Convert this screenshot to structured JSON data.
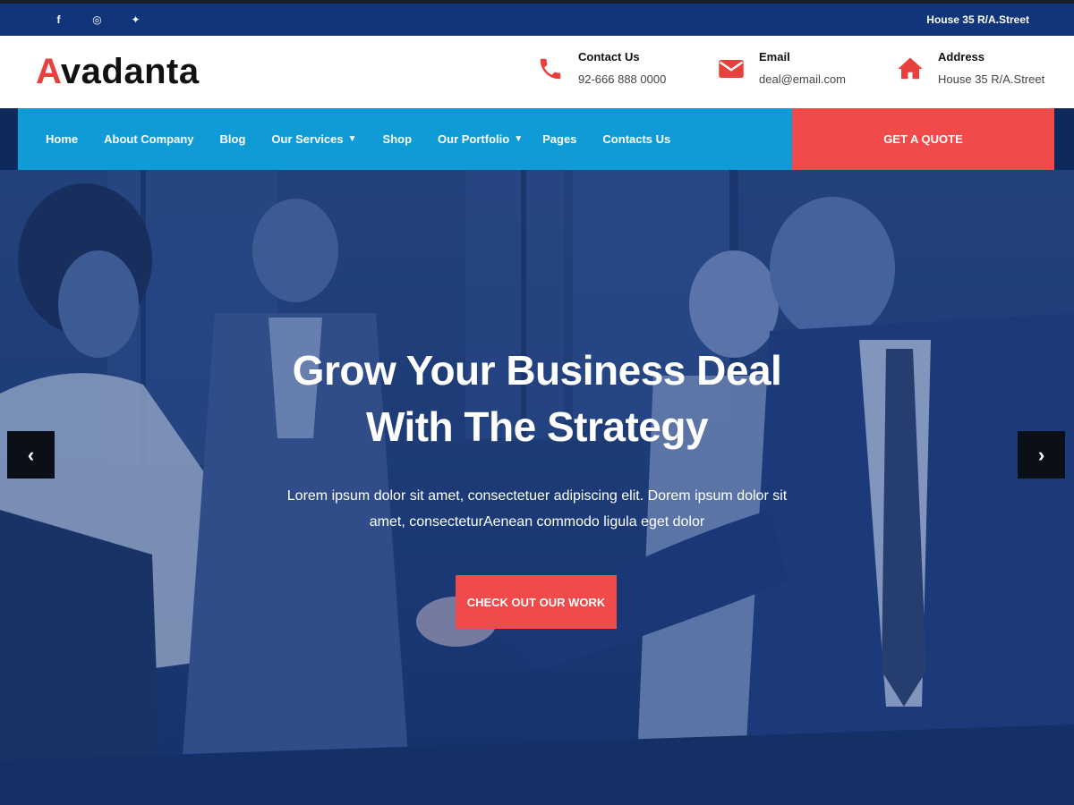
{
  "topbar": {
    "social": [
      {
        "icon": "facebook-icon",
        "glyph": "f"
      },
      {
        "icon": "instagram-icon",
        "glyph": "◎"
      },
      {
        "icon": "twitter-icon",
        "glyph": "✦"
      }
    ],
    "address": "House 35 R/A.Street"
  },
  "header": {
    "logo_first": "A",
    "logo_rest": "vadanta",
    "contact": {
      "label": "Contact Us",
      "value": "92-666 888 0000",
      "icon": "phone-icon"
    },
    "email": {
      "label": "Email",
      "value": "deal@email.com",
      "icon": "mail-icon"
    },
    "address": {
      "label": "Address",
      "value": "House 35 R/A.Street",
      "icon": "home-icon"
    }
  },
  "nav": {
    "items": [
      {
        "label": "Home"
      },
      {
        "label": "About Company"
      },
      {
        "label": "Blog"
      },
      {
        "label": "Our Services",
        "dropdown": true
      },
      {
        "label": "Shop"
      },
      {
        "label": "Our Portfolio",
        "dropdown": true
      },
      {
        "label": "Pages"
      },
      {
        "label": "Contacts Us"
      }
    ],
    "quote_label": "GET A QUOTE"
  },
  "hero": {
    "title_line1": "Grow Your Business Deal",
    "title_line2": "With The Strategy",
    "subtitle_line1": "Lorem ipsum dolor sit amet, consectetuer adipiscing elit. Dorem ipsum dolor sit",
    "subtitle_line2": "amet, consecteturAenean commodo ligula eget dolor",
    "cta_label": "CHECK OUT OUR WORK",
    "prev_glyph": "‹",
    "next_glyph": "›"
  },
  "colors": {
    "accent": "#f04a4a",
    "nav_blue": "#119bd6",
    "topbar": "#10357a",
    "hero_overlay": "#1f3d78"
  }
}
